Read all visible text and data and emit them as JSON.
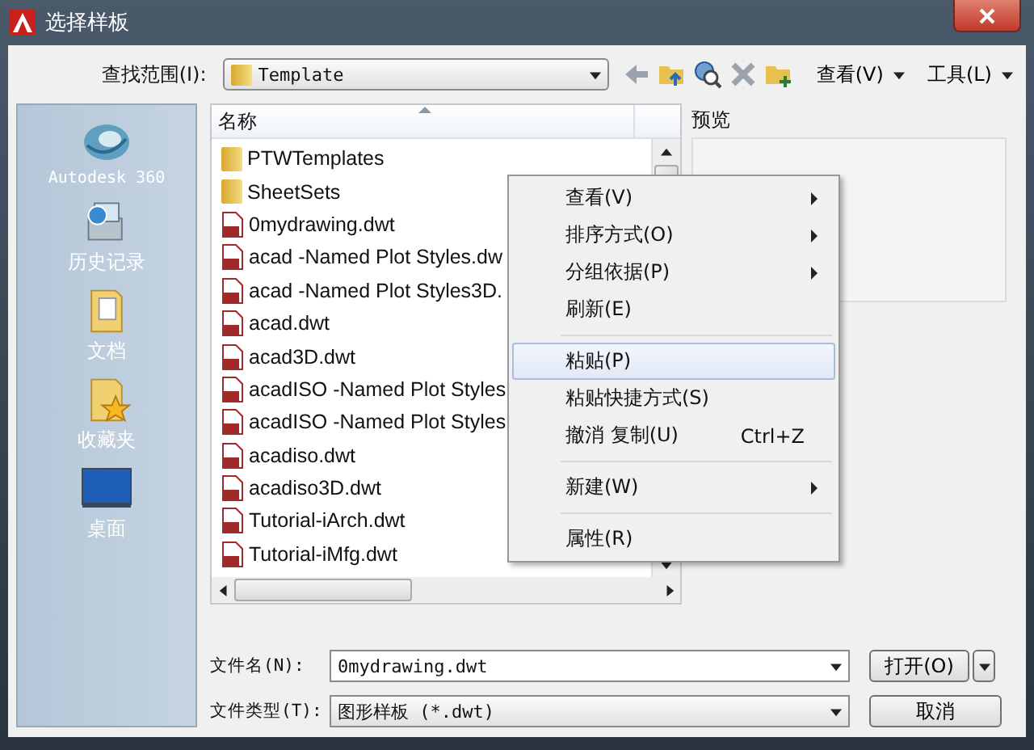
{
  "window": {
    "title": "选择样板"
  },
  "toolbar": {
    "look_in_label": "查找范围(I):",
    "look_in_value": "Template",
    "view_menu": "查看(V)",
    "tools_menu": "工具(L)"
  },
  "places": [
    {
      "label": "Autodesk 360",
      "kind": "cloud"
    },
    {
      "label": "历史记录",
      "kind": "history"
    },
    {
      "label": "文档",
      "kind": "documents"
    },
    {
      "label": "收藏夹",
      "kind": "favorites"
    },
    {
      "label": "桌面",
      "kind": "desktop"
    }
  ],
  "file_list": {
    "column": "名称",
    "rows": [
      {
        "name": "PTWTemplates",
        "kind": "folder"
      },
      {
        "name": "SheetSets",
        "kind": "folder"
      },
      {
        "name": "0mydrawing.dwt",
        "kind": "template"
      },
      {
        "name": "acad -Named Plot Styles.dw",
        "kind": "template"
      },
      {
        "name": "acad -Named Plot Styles3D.",
        "kind": "template"
      },
      {
        "name": "acad.dwt",
        "kind": "template"
      },
      {
        "name": "acad3D.dwt",
        "kind": "template"
      },
      {
        "name": "acadISO -Named Plot Styles",
        "kind": "template"
      },
      {
        "name": "acadISO -Named Plot Styles",
        "kind": "template"
      },
      {
        "name": "acadiso.dwt",
        "kind": "template"
      },
      {
        "name": "acadiso3D.dwt",
        "kind": "template"
      },
      {
        "name": "Tutorial-iArch.dwt",
        "kind": "template"
      },
      {
        "name": "Tutorial-iMfg.dwt",
        "kind": "template"
      }
    ]
  },
  "preview": {
    "label": "预览"
  },
  "context_menu": [
    {
      "kind": "item",
      "label": "查看(V)",
      "submenu": true,
      "selected": false
    },
    {
      "kind": "item",
      "label": "排序方式(O)",
      "submenu": true,
      "selected": false
    },
    {
      "kind": "item",
      "label": "分组依据(P)",
      "submenu": true,
      "selected": false
    },
    {
      "kind": "item",
      "label": "刷新(E)",
      "submenu": false,
      "selected": false
    },
    {
      "kind": "separator"
    },
    {
      "kind": "item",
      "label": "粘贴(P)",
      "submenu": false,
      "selected": true
    },
    {
      "kind": "item",
      "label": "粘贴快捷方式(S)",
      "submenu": false,
      "selected": false
    },
    {
      "kind": "item",
      "label": "撤消 复制(U)",
      "submenu": false,
      "selected": false,
      "shortcut": "Ctrl+Z"
    },
    {
      "kind": "separator"
    },
    {
      "kind": "item",
      "label": "新建(W)",
      "submenu": true,
      "selected": false
    },
    {
      "kind": "separator"
    },
    {
      "kind": "item",
      "label": "属性(R)",
      "submenu": false,
      "selected": false
    }
  ],
  "file_name": {
    "label": "文件名(N):",
    "value": "0mydrawing.dwt"
  },
  "file_type": {
    "label": "文件类型(T):",
    "value": "图形样板 (*.dwt)"
  },
  "buttons": [
    {
      "label": "打开(O)",
      "kind": "split"
    },
    {
      "label": "取消",
      "kind": "plain"
    }
  ]
}
